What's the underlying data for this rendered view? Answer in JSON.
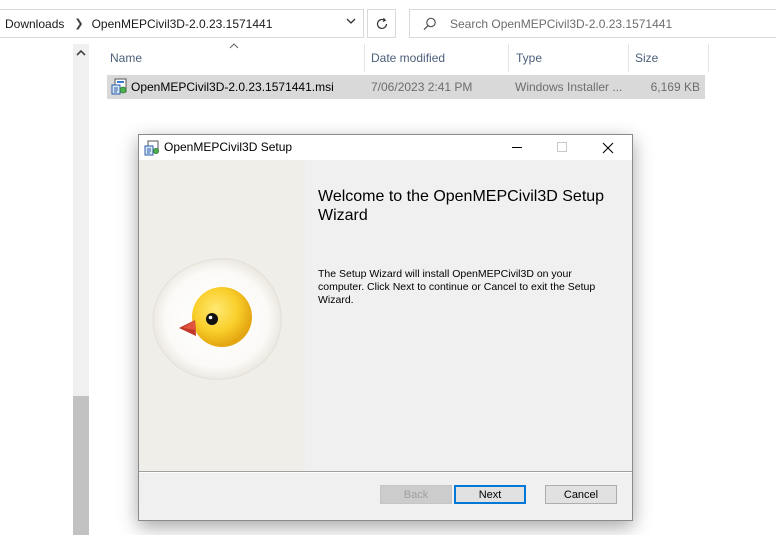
{
  "address_bar": {
    "crumbs": [
      "Downloads",
      "OpenMEPCivil3D-2.0.23.1571441"
    ],
    "dropdown_icon": "chevron-down-icon",
    "refresh_icon": "refresh-icon"
  },
  "search": {
    "placeholder": "Search OpenMEPCivil3D-2.0.23.1571441",
    "icon": "search-icon"
  },
  "file_list": {
    "columns": {
      "name": "Name",
      "date": "Date modified",
      "type": "Type",
      "size": "Size"
    },
    "sort_icon": "sort-up-icon",
    "rows": [
      {
        "name": "OpenMEPCivil3D-2.0.23.1571441.msi",
        "date": "7/06/2023 2:41 PM",
        "type": "Windows Installer ...",
        "size": "6,169 KB",
        "icon": "msi-file-icon"
      }
    ]
  },
  "dialog": {
    "title": "OpenMEPCivil3D Setup",
    "heading": "Welcome to the OpenMEPCivil3D Setup Wizard",
    "body": "The Setup Wizard will install OpenMEPCivil3D on your computer. Click Next to continue or Cancel to exit the Setup Wizard.",
    "buttons": {
      "back": "Back",
      "next": "Next",
      "cancel": "Cancel"
    },
    "banner_icon": "egg-chick-logo-icon"
  },
  "colors": {
    "selected_row": "#d9d9d9",
    "dialog_bg": "#f0f0f0",
    "default_button_border": "#0078d7",
    "header_text": "#4c607a"
  }
}
